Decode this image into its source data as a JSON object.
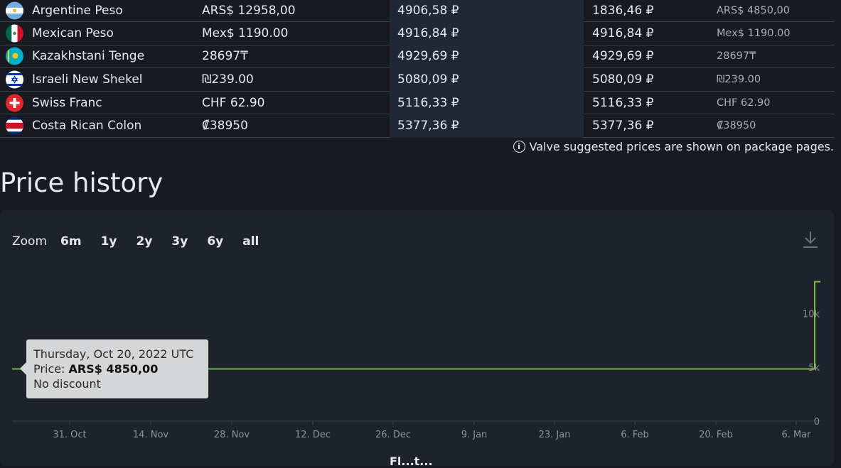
{
  "currencies": [
    {
      "flag": "flag-argentina-icon",
      "name": "Argentine Peso",
      "price": "ARS$ 12958,00",
      "rub_converted": "4906,58 ₽",
      "rub_original": "1836,46 ₽",
      "original_price": "ARS$ 4850,00"
    },
    {
      "flag": "flag-mexico-icon",
      "name": "Mexican Peso",
      "price": "Mex$ 1190.00",
      "rub_converted": "4916,84 ₽",
      "rub_original": "4916,84 ₽",
      "original_price": "Mex$ 1190.00"
    },
    {
      "flag": "flag-kazakhstan-icon",
      "name": "Kazakhstani Tenge",
      "price": "28697₸",
      "rub_converted": "4929,69 ₽",
      "rub_original": "4929,69 ₽",
      "original_price": "28697₸"
    },
    {
      "flag": "flag-israel-icon",
      "name": "Israeli New Shekel",
      "price": "₪239.00",
      "rub_converted": "5080,09 ₽",
      "rub_original": "5080,09 ₽",
      "original_price": "₪239.00"
    },
    {
      "flag": "flag-switzerland-icon",
      "name": "Swiss Franc",
      "price": "CHF 62.90",
      "rub_converted": "5116,33 ₽",
      "rub_original": "5116,33 ₽",
      "original_price": "CHF 62.90"
    },
    {
      "flag": "flag-costa-rica-icon",
      "name": "Costa Rican Colon",
      "price": "₡38950",
      "rub_converted": "5377,36 ₽",
      "rub_original": "5377,36 ₽",
      "original_price": "₡38950"
    }
  ],
  "note": {
    "icon": "info-icon",
    "text": "Valve suggested prices are shown on package pages."
  },
  "section_title": "Price history",
  "zoom": {
    "label": "Zoom",
    "options": [
      "6m",
      "1y",
      "2y",
      "3y",
      "6y",
      "all"
    ]
  },
  "download_icon": "download-icon",
  "tooltip": {
    "date": "Thursday, Oct 20, 2022 UTC",
    "price_label": "Price:",
    "price_value": "ARS$ 4850,00",
    "discount": "No discount"
  },
  "partial_label": "Fl...t...",
  "colors": {
    "line": "#7bbb3c",
    "background": "#171a21",
    "panel": "#1d222b",
    "tooltip": "#d5d6d7"
  },
  "chart_data": {
    "type": "line",
    "series": [
      {
        "values": [
          {
            "x": "2022-10-20",
            "y": 4850
          },
          {
            "x": "2023-03-09",
            "y": 4850
          },
          {
            "x": "2023-03-09",
            "y": 12958
          },
          {
            "x": "2023-03-10",
            "y": 12958
          }
        ]
      }
    ],
    "x_ticks": [
      "31. Oct",
      "14. Nov",
      "28. Nov",
      "12. Dec",
      "26. Dec",
      "9. Jan",
      "23. Jan",
      "6. Feb",
      "20. Feb",
      "6. Mar"
    ],
    "y_ticks": [
      "0",
      "5k",
      "10k"
    ],
    "ylim": [
      0,
      13000
    ],
    "grid": false
  }
}
